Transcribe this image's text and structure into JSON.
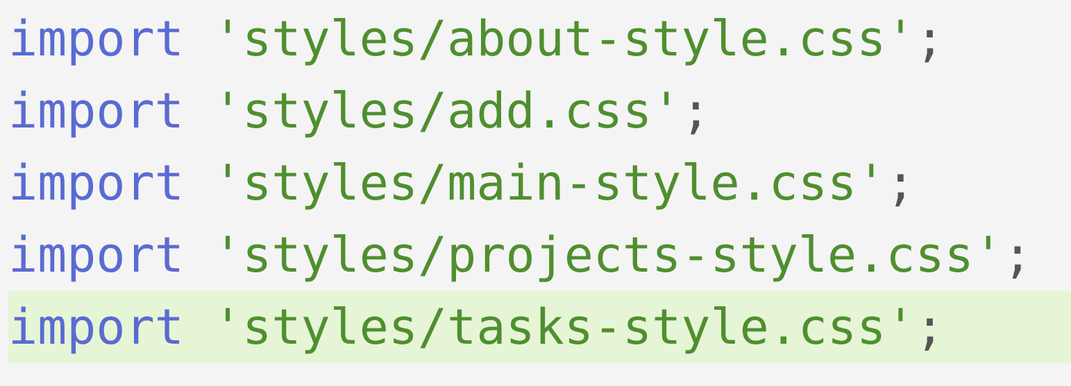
{
  "editor": {
    "lines": [
      {
        "keyword": "import",
        "string": "'styles/about-style.css'",
        "punct": ";"
      },
      {
        "keyword": "import",
        "string": "'styles/add.css'",
        "punct": ";"
      },
      {
        "keyword": "import",
        "string": "'styles/main-style.css'",
        "punct": ";"
      },
      {
        "keyword": "import",
        "string": "'styles/projects-style.css'",
        "punct": ";"
      },
      {
        "keyword": "import",
        "string": "'styles/tasks-style.css'",
        "punct": ";"
      }
    ],
    "highlighted_line": 5,
    "colors": {
      "keyword": "#5a6bd2",
      "string": "#4f8f2f",
      "highlight": "#e6f5d6",
      "background": "#f4f4f4"
    }
  }
}
